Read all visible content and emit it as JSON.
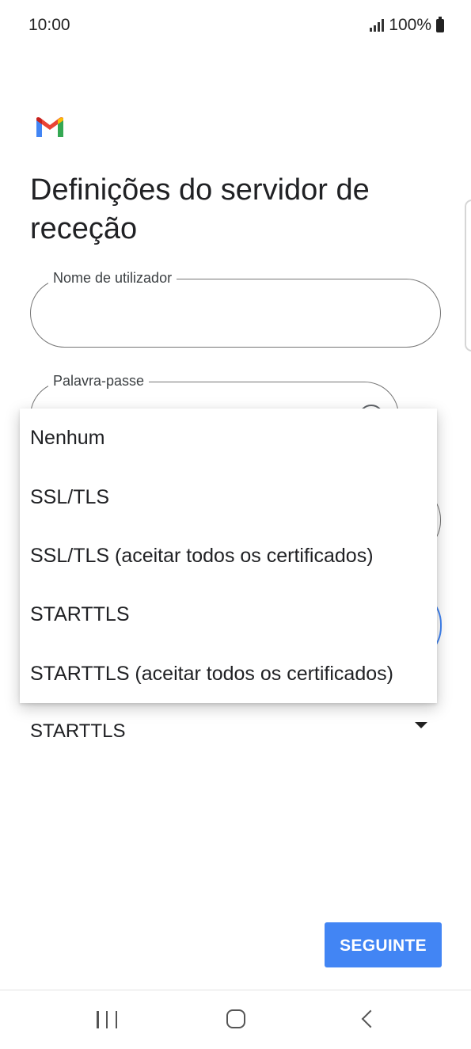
{
  "status_bar": {
    "time": "10:00",
    "battery": "100%",
    "icons": [
      "signal-icon",
      "battery-icon"
    ]
  },
  "app": {
    "logo": "gmail-logo",
    "title": "Definições do servidor de receção"
  },
  "form": {
    "username": {
      "label": "Nome de utilizador",
      "value": ""
    },
    "password": {
      "label": "Palavra-passe",
      "value": "",
      "icon": "eye-icon"
    },
    "security_type": {
      "value": "STARTTLS",
      "icon": "chevron-down-icon"
    }
  },
  "dropdown": {
    "options": [
      "Nenhum",
      "SSL/TLS",
      "SSL/TLS (aceitar todos os certificados)",
      "STARTTLS",
      "STARTTLS (aceitar todos os certificados)"
    ]
  },
  "actions": {
    "next_label": "SEGUINTE"
  },
  "colors": {
    "accent": "#4285f4",
    "text": "#202124",
    "outline": "#757575"
  },
  "nav_bar": {
    "icons": [
      "recents-icon",
      "home-icon",
      "back-icon"
    ]
  }
}
